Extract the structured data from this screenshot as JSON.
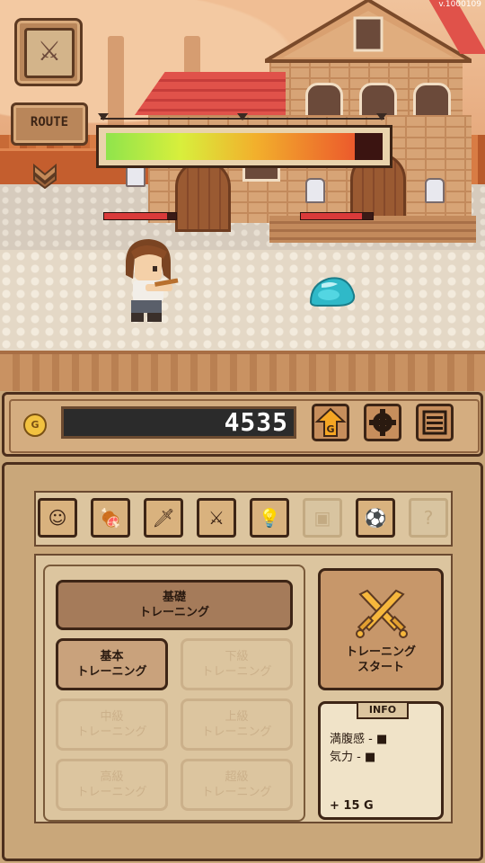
{
  "version": "v.1000109",
  "hud": {
    "route_label": "ROUTE",
    "gauge_fill_fraction": 0.9
  },
  "battle": {
    "player_hp_fraction": 0.88,
    "enemy_hp_fraction": 0.85
  },
  "gold": {
    "coin_icon_label": "G",
    "amount": "4535",
    "upgrade_icon_label": "G"
  },
  "tabs": [
    {
      "icon": "character-icon",
      "glyph": "☺",
      "enabled": true
    },
    {
      "icon": "meat-icon",
      "glyph": "🍖",
      "enabled": true
    },
    {
      "icon": "sword-icon",
      "glyph": "🗡",
      "enabled": true
    },
    {
      "icon": "crossed-swords-icon",
      "glyph": "⚔",
      "enabled": true
    },
    {
      "icon": "lightbulb-icon",
      "glyph": "💡",
      "enabled": true
    },
    {
      "icon": "frame-icon",
      "glyph": "▣",
      "enabled": false
    },
    {
      "icon": "soccer-ball-icon",
      "glyph": "⚽",
      "enabled": true
    },
    {
      "icon": "question-icon",
      "glyph": "?",
      "enabled": false
    }
  ],
  "training": {
    "category_label": "基礎\nトレーニング",
    "levels": [
      {
        "label": "基本\nトレーニング",
        "state": "active"
      },
      {
        "label": "下級\nトレーニング",
        "state": "locked"
      },
      {
        "label": "中級\nトレーニング",
        "state": "locked"
      },
      {
        "label": "上級\nトレーニング",
        "state": "locked"
      },
      {
        "label": "高級\nトレーニング",
        "state": "locked"
      },
      {
        "label": "超級\nトレーニング",
        "state": "locked"
      }
    ],
    "start_label": "トレーニング\nスタート"
  },
  "info": {
    "title": "INFO",
    "satiety": "満腹感 - ■",
    "energy": "気力 - ■",
    "reward": "+ 15 G"
  },
  "colors": {
    "panel_bg": "#c9a77a",
    "border": "#3d2516",
    "gauge_start": "#8fe44c",
    "gauge_end": "#ec5a2c"
  }
}
